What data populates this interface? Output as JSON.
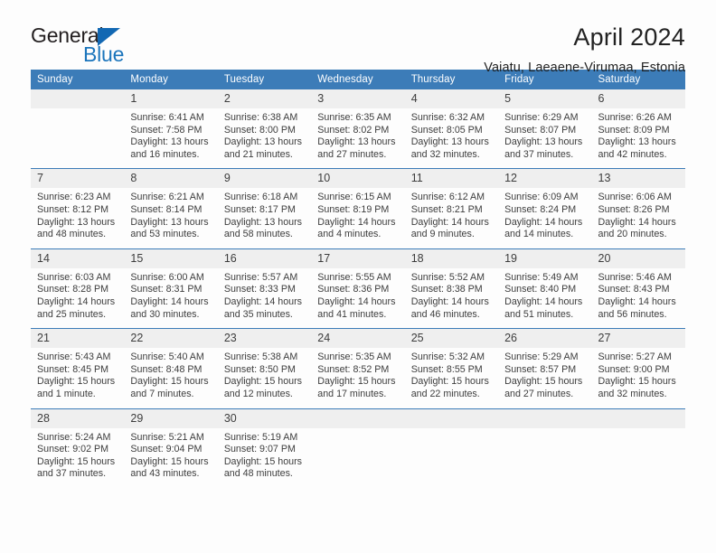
{
  "logo": {
    "word1": "General",
    "word2": "Blue",
    "triangle_color": "#1268b3",
    "word2_color": "#1b75bc"
  },
  "header": {
    "title": "April 2024",
    "subtitle": "Vaiatu, Laeaene-Virumaa, Estonia"
  },
  "theme": {
    "header_blue": "#3c7cb8",
    "date_band_gray": "#efefef",
    "page_background": "#fdfdfd",
    "text": "#3d3d3d"
  },
  "calendar": {
    "weekday_headers": [
      "Sunday",
      "Monday",
      "Tuesday",
      "Wednesday",
      "Thursday",
      "Friday",
      "Saturday"
    ],
    "weeks": [
      [
        {
          "day": "",
          "sunrise": "",
          "sunset": "",
          "daylight_1": "",
          "daylight_2": ""
        },
        {
          "day": "1",
          "sunrise": "Sunrise: 6:41 AM",
          "sunset": "Sunset: 7:58 PM",
          "daylight_1": "Daylight: 13 hours",
          "daylight_2": "and 16 minutes."
        },
        {
          "day": "2",
          "sunrise": "Sunrise: 6:38 AM",
          "sunset": "Sunset: 8:00 PM",
          "daylight_1": "Daylight: 13 hours",
          "daylight_2": "and 21 minutes."
        },
        {
          "day": "3",
          "sunrise": "Sunrise: 6:35 AM",
          "sunset": "Sunset: 8:02 PM",
          "daylight_1": "Daylight: 13 hours",
          "daylight_2": "and 27 minutes."
        },
        {
          "day": "4",
          "sunrise": "Sunrise: 6:32 AM",
          "sunset": "Sunset: 8:05 PM",
          "daylight_1": "Daylight: 13 hours",
          "daylight_2": "and 32 minutes."
        },
        {
          "day": "5",
          "sunrise": "Sunrise: 6:29 AM",
          "sunset": "Sunset: 8:07 PM",
          "daylight_1": "Daylight: 13 hours",
          "daylight_2": "and 37 minutes."
        },
        {
          "day": "6",
          "sunrise": "Sunrise: 6:26 AM",
          "sunset": "Sunset: 8:09 PM",
          "daylight_1": "Daylight: 13 hours",
          "daylight_2": "and 42 minutes."
        }
      ],
      [
        {
          "day": "7",
          "sunrise": "Sunrise: 6:23 AM",
          "sunset": "Sunset: 8:12 PM",
          "daylight_1": "Daylight: 13 hours",
          "daylight_2": "and 48 minutes."
        },
        {
          "day": "8",
          "sunrise": "Sunrise: 6:21 AM",
          "sunset": "Sunset: 8:14 PM",
          "daylight_1": "Daylight: 13 hours",
          "daylight_2": "and 53 minutes."
        },
        {
          "day": "9",
          "sunrise": "Sunrise: 6:18 AM",
          "sunset": "Sunset: 8:17 PM",
          "daylight_1": "Daylight: 13 hours",
          "daylight_2": "and 58 minutes."
        },
        {
          "day": "10",
          "sunrise": "Sunrise: 6:15 AM",
          "sunset": "Sunset: 8:19 PM",
          "daylight_1": "Daylight: 14 hours",
          "daylight_2": "and 4 minutes."
        },
        {
          "day": "11",
          "sunrise": "Sunrise: 6:12 AM",
          "sunset": "Sunset: 8:21 PM",
          "daylight_1": "Daylight: 14 hours",
          "daylight_2": "and 9 minutes."
        },
        {
          "day": "12",
          "sunrise": "Sunrise: 6:09 AM",
          "sunset": "Sunset: 8:24 PM",
          "daylight_1": "Daylight: 14 hours",
          "daylight_2": "and 14 minutes."
        },
        {
          "day": "13",
          "sunrise": "Sunrise: 6:06 AM",
          "sunset": "Sunset: 8:26 PM",
          "daylight_1": "Daylight: 14 hours",
          "daylight_2": "and 20 minutes."
        }
      ],
      [
        {
          "day": "14",
          "sunrise": "Sunrise: 6:03 AM",
          "sunset": "Sunset: 8:28 PM",
          "daylight_1": "Daylight: 14 hours",
          "daylight_2": "and 25 minutes."
        },
        {
          "day": "15",
          "sunrise": "Sunrise: 6:00 AM",
          "sunset": "Sunset: 8:31 PM",
          "daylight_1": "Daylight: 14 hours",
          "daylight_2": "and 30 minutes."
        },
        {
          "day": "16",
          "sunrise": "Sunrise: 5:57 AM",
          "sunset": "Sunset: 8:33 PM",
          "daylight_1": "Daylight: 14 hours",
          "daylight_2": "and 35 minutes."
        },
        {
          "day": "17",
          "sunrise": "Sunrise: 5:55 AM",
          "sunset": "Sunset: 8:36 PM",
          "daylight_1": "Daylight: 14 hours",
          "daylight_2": "and 41 minutes."
        },
        {
          "day": "18",
          "sunrise": "Sunrise: 5:52 AM",
          "sunset": "Sunset: 8:38 PM",
          "daylight_1": "Daylight: 14 hours",
          "daylight_2": "and 46 minutes."
        },
        {
          "day": "19",
          "sunrise": "Sunrise: 5:49 AM",
          "sunset": "Sunset: 8:40 PM",
          "daylight_1": "Daylight: 14 hours",
          "daylight_2": "and 51 minutes."
        },
        {
          "day": "20",
          "sunrise": "Sunrise: 5:46 AM",
          "sunset": "Sunset: 8:43 PM",
          "daylight_1": "Daylight: 14 hours",
          "daylight_2": "and 56 minutes."
        }
      ],
      [
        {
          "day": "21",
          "sunrise": "Sunrise: 5:43 AM",
          "sunset": "Sunset: 8:45 PM",
          "daylight_1": "Daylight: 15 hours",
          "daylight_2": "and 1 minute."
        },
        {
          "day": "22",
          "sunrise": "Sunrise: 5:40 AM",
          "sunset": "Sunset: 8:48 PM",
          "daylight_1": "Daylight: 15 hours",
          "daylight_2": "and 7 minutes."
        },
        {
          "day": "23",
          "sunrise": "Sunrise: 5:38 AM",
          "sunset": "Sunset: 8:50 PM",
          "daylight_1": "Daylight: 15 hours",
          "daylight_2": "and 12 minutes."
        },
        {
          "day": "24",
          "sunrise": "Sunrise: 5:35 AM",
          "sunset": "Sunset: 8:52 PM",
          "daylight_1": "Daylight: 15 hours",
          "daylight_2": "and 17 minutes."
        },
        {
          "day": "25",
          "sunrise": "Sunrise: 5:32 AM",
          "sunset": "Sunset: 8:55 PM",
          "daylight_1": "Daylight: 15 hours",
          "daylight_2": "and 22 minutes."
        },
        {
          "day": "26",
          "sunrise": "Sunrise: 5:29 AM",
          "sunset": "Sunset: 8:57 PM",
          "daylight_1": "Daylight: 15 hours",
          "daylight_2": "and 27 minutes."
        },
        {
          "day": "27",
          "sunrise": "Sunrise: 5:27 AM",
          "sunset": "Sunset: 9:00 PM",
          "daylight_1": "Daylight: 15 hours",
          "daylight_2": "and 32 minutes."
        }
      ],
      [
        {
          "day": "28",
          "sunrise": "Sunrise: 5:24 AM",
          "sunset": "Sunset: 9:02 PM",
          "daylight_1": "Daylight: 15 hours",
          "daylight_2": "and 37 minutes."
        },
        {
          "day": "29",
          "sunrise": "Sunrise: 5:21 AM",
          "sunset": "Sunset: 9:04 PM",
          "daylight_1": "Daylight: 15 hours",
          "daylight_2": "and 43 minutes."
        },
        {
          "day": "30",
          "sunrise": "Sunrise: 5:19 AM",
          "sunset": "Sunset: 9:07 PM",
          "daylight_1": "Daylight: 15 hours",
          "daylight_2": "and 48 minutes."
        },
        {
          "day": "",
          "sunrise": "",
          "sunset": "",
          "daylight_1": "",
          "daylight_2": ""
        },
        {
          "day": "",
          "sunrise": "",
          "sunset": "",
          "daylight_1": "",
          "daylight_2": ""
        },
        {
          "day": "",
          "sunrise": "",
          "sunset": "",
          "daylight_1": "",
          "daylight_2": ""
        },
        {
          "day": "",
          "sunrise": "",
          "sunset": "",
          "daylight_1": "",
          "daylight_2": ""
        }
      ]
    ]
  }
}
